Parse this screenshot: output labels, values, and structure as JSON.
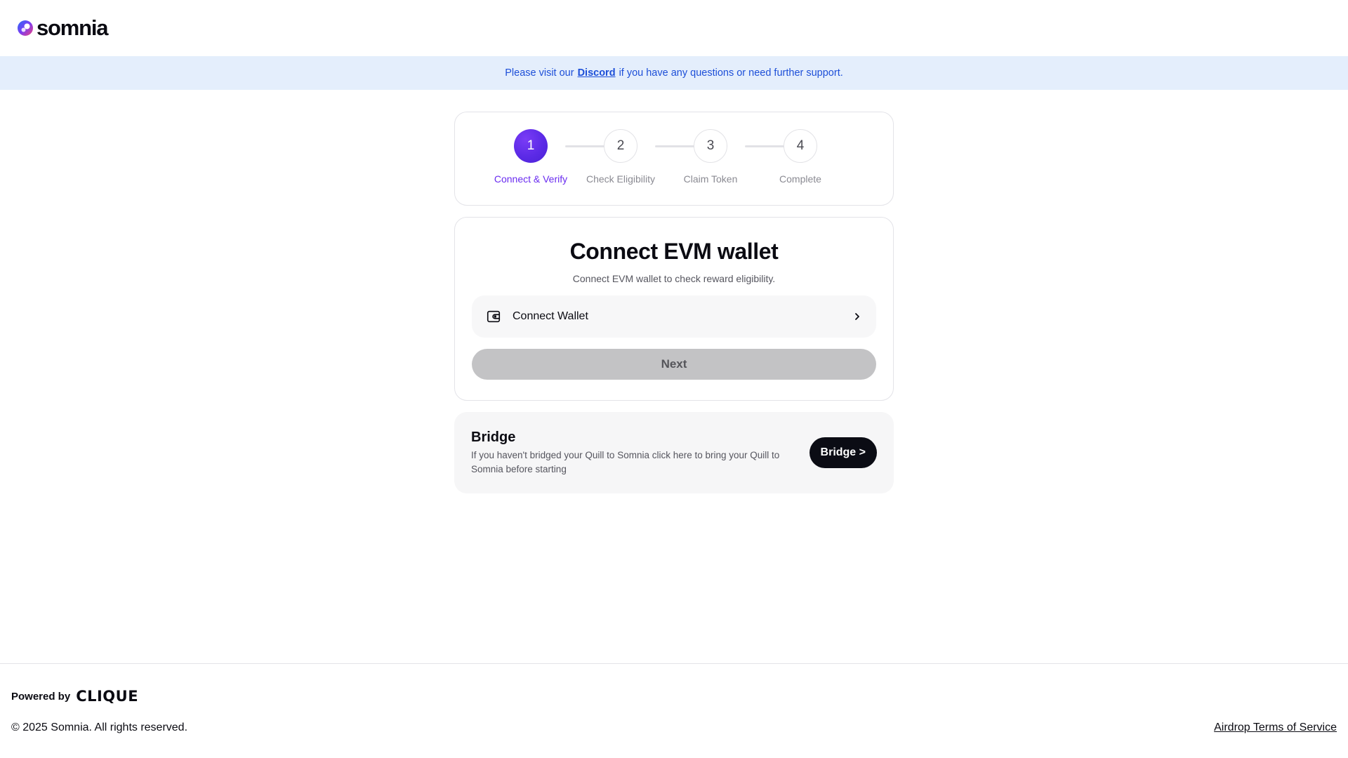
{
  "brand": {
    "name": "somnia"
  },
  "banner": {
    "prefix": "Please visit our",
    "link": "Discord",
    "suffix": "if you have any questions or need further support."
  },
  "stepper": {
    "active_step": 1,
    "steps": [
      {
        "number": "1",
        "label": "Connect & Verify"
      },
      {
        "number": "2",
        "label": "Check Eligibility"
      },
      {
        "number": "3",
        "label": "Claim Token"
      },
      {
        "number": "4",
        "label": "Complete"
      }
    ]
  },
  "connect_card": {
    "title": "Connect EVM wallet",
    "subtitle": "Connect EVM wallet to check reward eligibility.",
    "wallet_label": "Connect Wallet",
    "wallet_icon": "wallet-icon",
    "next_label": "Next"
  },
  "bridge_card": {
    "title": "Bridge",
    "description": "If you haven't bridged your Quill to Somnia click here to bring your Quill to Somnia before starting",
    "button_label": "Bridge >"
  },
  "footer": {
    "powered_by": "Powered by",
    "powered_brand": "CLIQUE",
    "copyright": "© 2025 Somnia. All rights reserved.",
    "terms_link": "Airdrop Terms of Service"
  },
  "colors": {
    "accent": "#6a2cf0",
    "banner_bg": "#e4eefc",
    "banner_text": "#1d4fd8",
    "dark_button": "#0b0c14",
    "disabled_button": "#c3c3c5"
  }
}
